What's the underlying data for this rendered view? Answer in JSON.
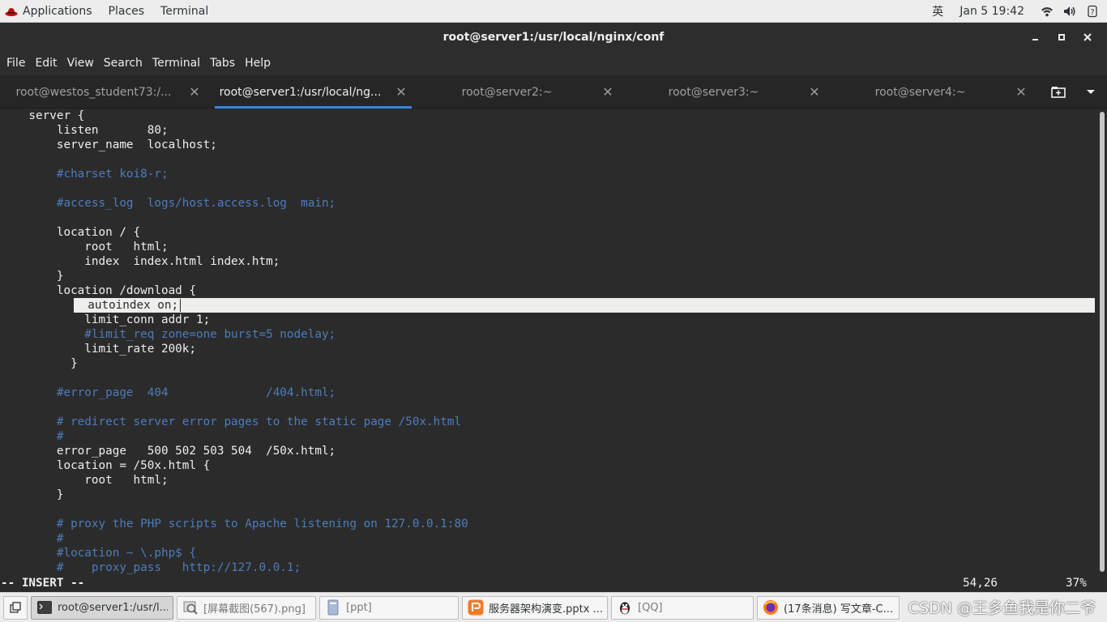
{
  "topbar": {
    "applications": "Applications",
    "places": "Places",
    "terminal": "Terminal",
    "input_method": "英",
    "datetime": "Jan 5  19:42"
  },
  "window": {
    "title": "root@server1:/usr/local/nginx/conf"
  },
  "menubar": [
    "File",
    "Edit",
    "View",
    "Search",
    "Terminal",
    "Tabs",
    "Help"
  ],
  "tabs": [
    {
      "label": "root@westos_student73:/...",
      "active": false
    },
    {
      "label": "root@server1:/usr/local/ng...",
      "active": true
    },
    {
      "label": "root@server2:~",
      "active": false
    },
    {
      "label": "root@server3:~",
      "active": false
    },
    {
      "label": "root@server4:~",
      "active": false
    }
  ],
  "editor": {
    "lines": [
      {
        "text": "    server {",
        "type": "code"
      },
      {
        "text": "        listen       80;",
        "type": "code"
      },
      {
        "text": "        server_name  localhost;",
        "type": "code"
      },
      {
        "text": "",
        "type": "code"
      },
      {
        "text": "        #charset koi8-r;",
        "type": "comment"
      },
      {
        "text": "",
        "type": "code"
      },
      {
        "text": "        #access_log  logs/host.access.log  main;",
        "type": "comment"
      },
      {
        "text": "",
        "type": "code"
      },
      {
        "text": "        location / {",
        "type": "code"
      },
      {
        "text": "            root   html;",
        "type": "code"
      },
      {
        "text": "            index  index.html index.htm;",
        "type": "code"
      },
      {
        "text": "        }",
        "type": "code"
      },
      {
        "text": "        location /download {",
        "type": "code"
      },
      {
        "text": "  autoindex on;",
        "type": "cursor"
      },
      {
        "text": "            limit_conn addr 1;",
        "type": "code"
      },
      {
        "text": "            #limit_req zone=one burst=5 nodelay;",
        "type": "comment"
      },
      {
        "text": "            limit_rate 200k;",
        "type": "code"
      },
      {
        "text": "          }",
        "type": "code"
      },
      {
        "text": "",
        "type": "code"
      },
      {
        "text": "        #error_page  404              /404.html;",
        "type": "comment"
      },
      {
        "text": "",
        "type": "code"
      },
      {
        "text": "        # redirect server error pages to the static page /50x.html",
        "type": "comment"
      },
      {
        "text": "        #",
        "type": "comment"
      },
      {
        "text": "        error_page   500 502 503 504  /50x.html;",
        "type": "code"
      },
      {
        "text": "        location = /50x.html {",
        "type": "code"
      },
      {
        "text": "            root   html;",
        "type": "code"
      },
      {
        "text": "        }",
        "type": "code"
      },
      {
        "text": "",
        "type": "code"
      },
      {
        "text": "        # proxy the PHP scripts to Apache listening on 127.0.0.1:80",
        "type": "comment"
      },
      {
        "text": "        #",
        "type": "comment"
      },
      {
        "text": "        #location ~ \\.php$ {",
        "type": "comment"
      },
      {
        "text": "        #    proxy_pass   http://127.0.0.1;",
        "type": "comment"
      }
    ],
    "mode": "-- INSERT --",
    "position": "54,26",
    "percent": "37%"
  },
  "taskbar": {
    "tasks": [
      {
        "label": "root@server1:/usr/l...",
        "icon": "terminal-icon",
        "active": true
      },
      {
        "label": "[屏幕截图(567).png]",
        "icon": "image-viewer-icon",
        "active": false
      },
      {
        "label": "[ppt]",
        "icon": "file-manager-icon",
        "active": false
      },
      {
        "label": "服务器架构演变.pptx ...",
        "icon": "presentation-icon",
        "active": false
      },
      {
        "label": "[QQ]",
        "icon": "qq-penguin-icon",
        "active": false
      },
      {
        "label": "(17条消息) 写文章-C...",
        "icon": "firefox-icon",
        "active": false
      }
    ],
    "watermark": "CSDN @王多鱼我是你二爷"
  },
  "colors": {
    "terminal_bg": "#2b2b2b",
    "terminal_fg": "#eeeeec",
    "comment": "#4e7cbb",
    "tab_accent": "#3584e4"
  }
}
